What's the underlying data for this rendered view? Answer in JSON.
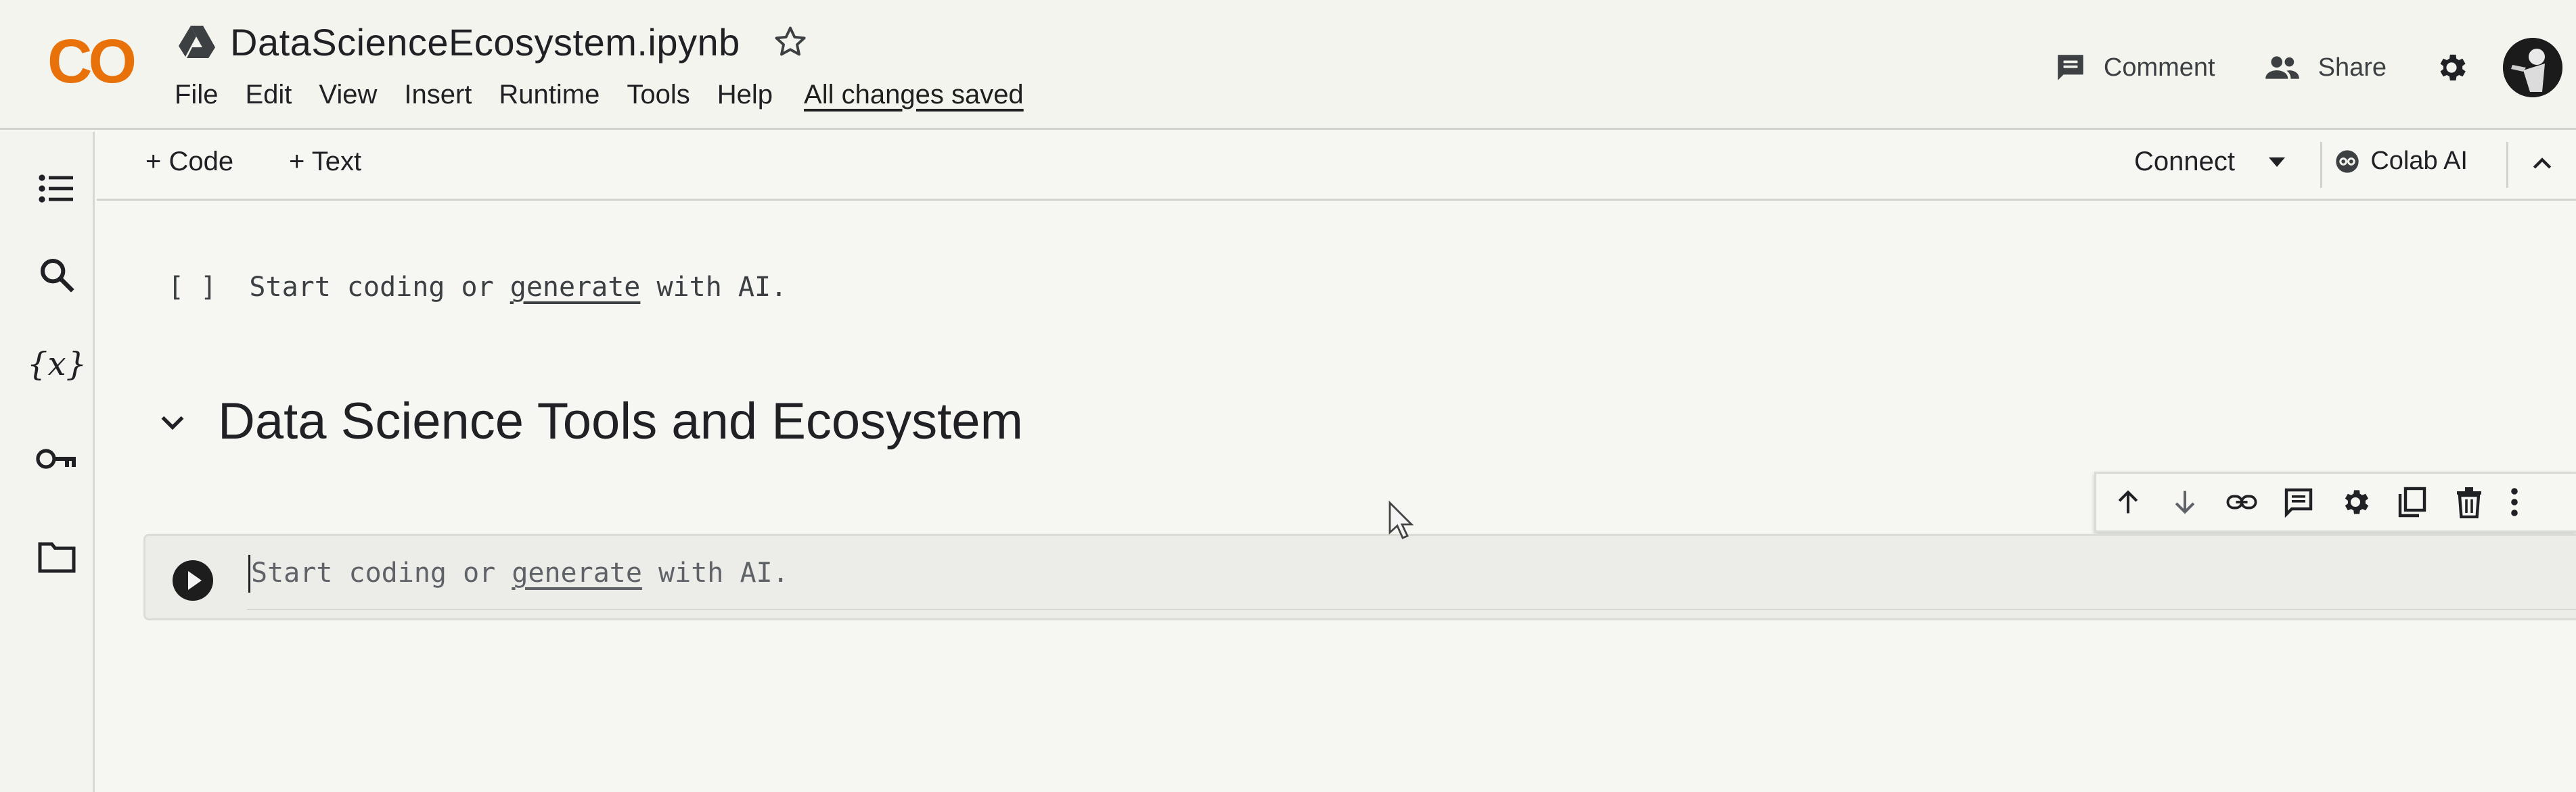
{
  "app": {
    "logo_text": "CO",
    "notebook_title": "DataScienceEcosystem.ipynb",
    "save_status": "All changes saved"
  },
  "menu": {
    "items": [
      "File",
      "Edit",
      "View",
      "Insert",
      "Runtime",
      "Tools",
      "Help"
    ]
  },
  "header_actions": {
    "comment_label": "Comment",
    "share_label": "Share"
  },
  "toolbar": {
    "add_code_label": "+ Code",
    "add_text_label": "+ Text",
    "connect_label": "Connect",
    "colab_ai_label": "Colab AI"
  },
  "sidebar": {
    "items": [
      "table-of-contents",
      "search",
      "variables",
      "secrets",
      "files"
    ],
    "variables_glyph": "{x}"
  },
  "cells": {
    "empty_cell": {
      "brackets": "[ ]",
      "prefix": "Start coding or ",
      "link": "generate",
      "suffix": " with AI."
    },
    "heading": "Data Science Tools and Ecosystem",
    "active_cell": {
      "prefix": "Start coding or ",
      "link": "generate",
      "suffix": " with AI."
    }
  },
  "cell_toolbar": {
    "icons": [
      "move-up",
      "move-down",
      "link",
      "comment",
      "settings",
      "mirror",
      "delete",
      "more"
    ]
  },
  "colors": {
    "logo_orange": "#f08a00",
    "logo_red": "#d93a1e",
    "text_primary": "#202124",
    "background": "#f6f7f3"
  }
}
